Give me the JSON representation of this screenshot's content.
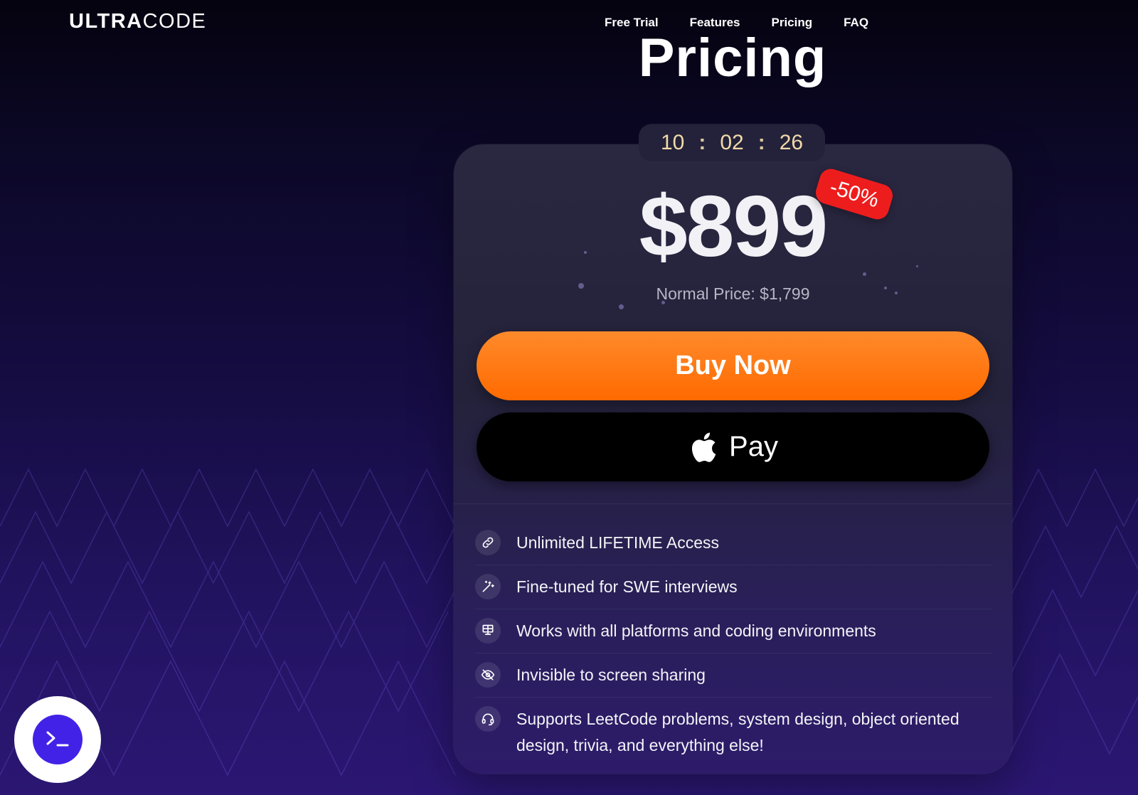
{
  "brand": {
    "logo_bold": "ULTRA",
    "logo_light": "CODE"
  },
  "nav": [
    {
      "label": "Free Trial"
    },
    {
      "label": "Features"
    },
    {
      "label": "Pricing"
    },
    {
      "label": "FAQ"
    }
  ],
  "page_title": "Pricing",
  "timer": {
    "hours": "10",
    "minutes": "02",
    "seconds": "26",
    "separator": ":"
  },
  "pricing": {
    "price": "$899",
    "discount_badge": "-50%",
    "normal_price": "Normal Price: $1,799",
    "buy_label": "Buy Now",
    "apple_pay_label": "Pay"
  },
  "features": [
    {
      "icon": "link-icon",
      "text": "Unlimited LIFETIME Access"
    },
    {
      "icon": "magic-wand-icon",
      "text": "Fine-tuned for SWE interviews"
    },
    {
      "icon": "monitor-grid-icon",
      "text": "Works with all platforms and coding environments"
    },
    {
      "icon": "eye-off-icon",
      "text": "Invisible to screen sharing"
    },
    {
      "icon": "headset-icon",
      "text": "Supports LeetCode problems, system design, object oriented design, trivia, and everything else!"
    }
  ],
  "colors": {
    "accent_orange": "#ff6a00",
    "discount_red": "#ee1d1d",
    "launcher_purple": "#4322e8",
    "timer_gold": "#f1d9a8"
  },
  "launcher": {
    "icon": "terminal-icon"
  }
}
